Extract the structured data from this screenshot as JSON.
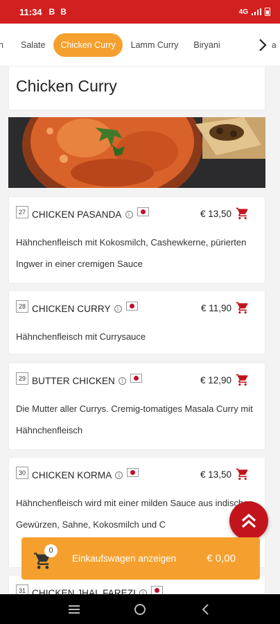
{
  "status": {
    "time": "11:34",
    "notif1": "B",
    "notif2": "B",
    "network": "4G"
  },
  "tabs": [
    {
      "label": "n"
    },
    {
      "label": "Salate"
    },
    {
      "label": "Chicken Curry",
      "active": true
    },
    {
      "label": "Lamm Curry"
    },
    {
      "label": "Biryani"
    },
    {
      "label": "a"
    }
  ],
  "category": {
    "title": "Chicken Curry"
  },
  "items": [
    {
      "no": "27",
      "name": "CHICKEN PASANDA",
      "price": "€ 13,50",
      "desc": "Hähnchenfleisch mit Kokosmilch, Cashewkerne, pürierten Ingwer in einer cremigen Sauce"
    },
    {
      "no": "28",
      "name": "CHICKEN CURRY",
      "price": "€ 11,90",
      "desc": "Hähnchenfleisch mit Currysauce"
    },
    {
      "no": "29",
      "name": "BUTTER CHICKEN",
      "price": "€ 12,90",
      "desc": "Die Mutter aller Currys. Cremig-tomatiges Masala Curry mit Hähnchenfleisch"
    },
    {
      "no": "30",
      "name": "CHICKEN KORMA",
      "price": "€ 13,50",
      "desc": "Hähnchenfleisch wird mit einer milden Sauce aus indischen Gewürzen, Sahne, Kokosmilch und C"
    },
    {
      "no": "31",
      "name": "CHICKEN JHAL FAREZI",
      "price": "",
      "desc": ""
    }
  ],
  "cart": {
    "count": "0",
    "label": "Einkaufswagen anzeigen",
    "total": "€ 0,00"
  },
  "colors": {
    "brand_red": "#d21f1f",
    "accent_orange": "#f5a02e",
    "cart_icon_red": "#c3131c"
  },
  "icons": [
    "info-icon",
    "flag-icon",
    "cart-icon",
    "chevron-right-icon",
    "scroll-top-icon",
    "menu-icon",
    "home-icon",
    "back-icon"
  ]
}
